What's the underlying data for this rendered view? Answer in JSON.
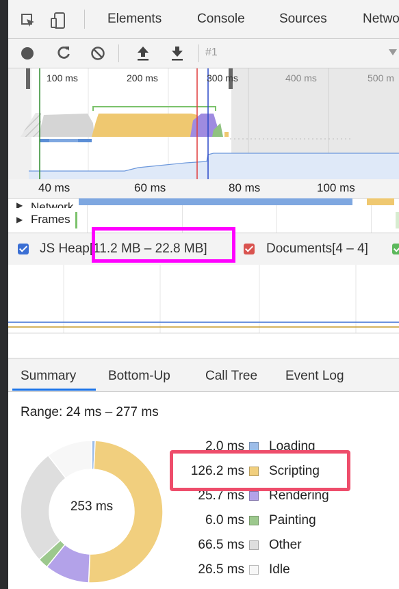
{
  "tabs": [
    "Elements",
    "Console",
    "Sources",
    "Netwo"
  ],
  "toolbar": {
    "recording_label": "#1",
    "dropdown_icon": "triangle-down-icon"
  },
  "overview": {
    "ticks": [
      "100 ms",
      "200 ms",
      "300 ms",
      "400 ms",
      "500 m"
    ]
  },
  "detail": {
    "ruler_ticks": [
      "40 ms",
      "60 ms",
      "80 ms",
      "100 ms"
    ],
    "network_label": "Network",
    "frames_label": "Frames"
  },
  "memory": {
    "js_heap_label": "JS Heap",
    "js_heap_range": "[11.2 MB – 22.8 MB]",
    "documents_label": "Documents",
    "documents_range": "[4 – 4]",
    "colors": {
      "js_heap": "#3b6fd4",
      "documents": "#d9534f",
      "nodes": "#5cb85c"
    }
  },
  "bottom_tabs": [
    "Summary",
    "Bottom-Up",
    "Call Tree",
    "Event Log"
  ],
  "summary": {
    "range": "Range: 24 ms – 277 ms",
    "total": "253 ms",
    "items": [
      {
        "value": "2.0 ms",
        "name": "Loading",
        "color": "#9dbde9"
      },
      {
        "value": "126.2 ms",
        "name": "Scripting",
        "color": "#f1cf7e"
      },
      {
        "value": "25.7 ms",
        "name": "Rendering",
        "color": "#b3a2e9"
      },
      {
        "value": "6.0 ms",
        "name": "Painting",
        "color": "#9cc88d"
      },
      {
        "value": "66.5 ms",
        "name": "Other",
        "color": "#dedede"
      },
      {
        "value": "26.5 ms",
        "name": "Idle",
        "color": "#f7f7f7"
      }
    ],
    "donut": [
      2.0,
      126.2,
      25.7,
      6.0,
      66.5,
      26.5
    ]
  }
}
